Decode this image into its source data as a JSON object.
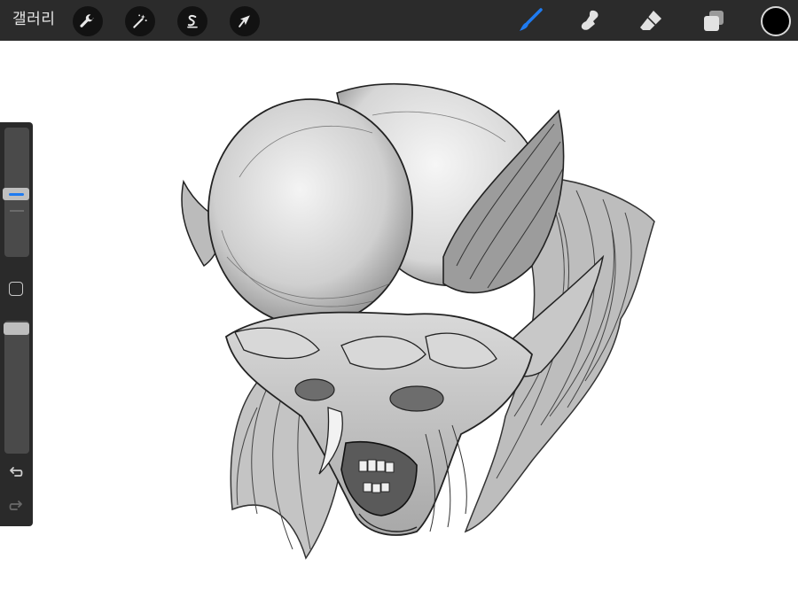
{
  "topbar": {
    "gallery_label": "갤러리",
    "actions": [
      {
        "icon": "wrench-icon"
      },
      {
        "icon": "magic-wand-icon"
      },
      {
        "icon": "selection-s-icon"
      },
      {
        "icon": "transform-arrow-icon"
      }
    ],
    "tools": [
      {
        "icon": "brush-icon",
        "active": true
      },
      {
        "icon": "smudge-icon",
        "active": false
      },
      {
        "icon": "eraser-icon",
        "active": false
      },
      {
        "icon": "layers-icon",
        "active": false
      }
    ],
    "current_color": "#000000",
    "active_tool_color": "#1f7bf0"
  },
  "sidebar": {
    "brush_size_level": 0.55,
    "opacity_level": 0.05,
    "icons": [
      "modify-square-icon",
      "undo-icon",
      "redo-icon"
    ]
  }
}
